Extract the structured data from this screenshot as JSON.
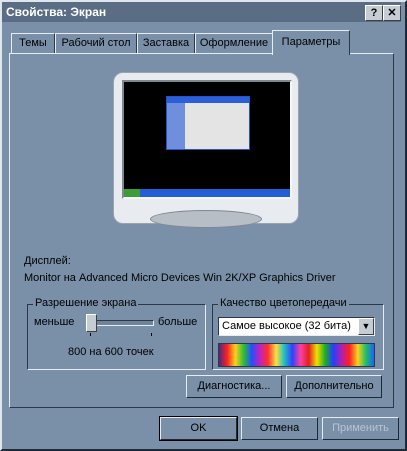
{
  "window": {
    "title": "Свойства: Экран",
    "help_label": "?",
    "close_label": "✕"
  },
  "tabs": [
    {
      "label": "Темы"
    },
    {
      "label": "Рабочий стол"
    },
    {
      "label": "Заставка"
    },
    {
      "label": "Оформление"
    },
    {
      "label": "Параметры"
    }
  ],
  "display": {
    "label": "Дисплей:",
    "value": "Monitor на Advanced Micro Devices Win 2K/XP Graphics Driver"
  },
  "resolution": {
    "group_title": "Разрешение экрана",
    "less_label": "меньше",
    "more_label": "больше",
    "value_text": "800 на 600 точек",
    "slider_fraction": 0.0
  },
  "color_quality": {
    "group_title": "Качество цветопередачи",
    "selected": "Самое высокое (32 бита)",
    "dropdown_arrow": "▼"
  },
  "buttons": {
    "troubleshoot": "Диагностика...",
    "advanced": "Дополнительно",
    "ok": "OK",
    "cancel": "Отмена",
    "apply": "Применить"
  }
}
